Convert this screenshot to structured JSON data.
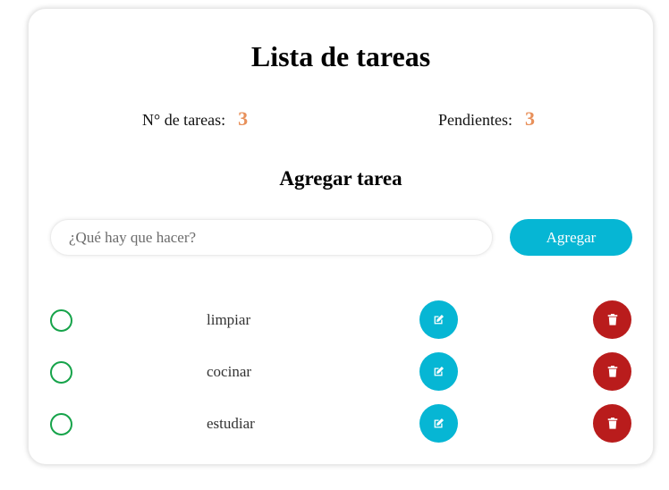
{
  "title": "Lista de tareas",
  "stats": {
    "total_label": "N° de tareas:",
    "total_value": "3",
    "pending_label": "Pendientes:",
    "pending_value": "3"
  },
  "add_section": {
    "heading": "Agregar tarea",
    "input_placeholder": "¿Qué hay que hacer?",
    "input_value": "",
    "button_label": "Agregar"
  },
  "tasks": [
    {
      "label": "limpiar",
      "done": false
    },
    {
      "label": "cocinar",
      "done": false
    },
    {
      "label": "estudiar",
      "done": false
    }
  ],
  "icons": {
    "check": "circle-outline-icon",
    "edit": "pencil-square-icon",
    "delete": "trash-icon"
  },
  "colors": {
    "accent": "#06b6d4",
    "danger": "#b91c1c",
    "stat_number": "#e8905a",
    "check_border": "#16a34a"
  }
}
